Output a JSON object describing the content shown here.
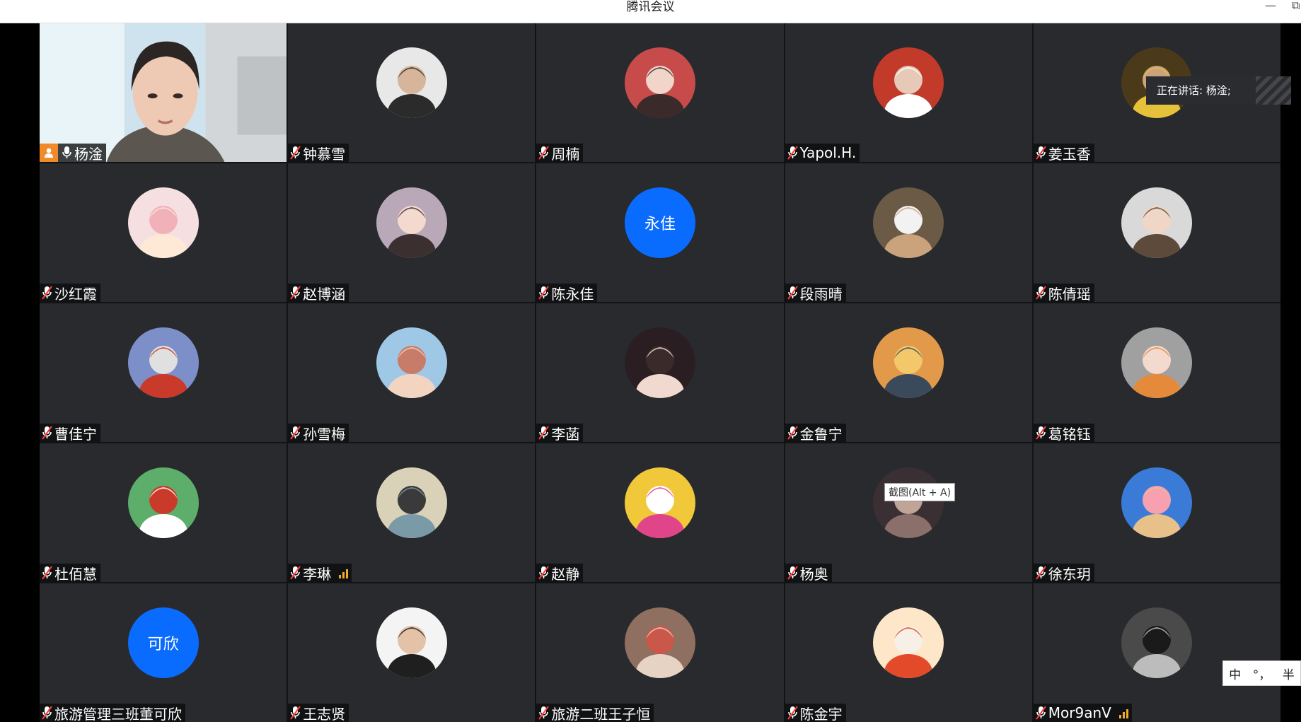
{
  "window": {
    "title": "腾讯会议",
    "min_label": "—",
    "restore_label": "⧉"
  },
  "speaking": {
    "text": "正在讲话: 杨淦;"
  },
  "tooltip": {
    "text": "截图(Alt + A)"
  },
  "ime": {
    "lang": "中",
    "punct": "°，",
    "width": "半"
  },
  "colors": {
    "tile_bg": "#282a2e",
    "accent_blue": "#0a6cff",
    "host_orange": "#f18a2a",
    "camera_border": "#2fbf6f"
  },
  "participants": [
    {
      "name": "杨淦",
      "type": "camera",
      "mic": "on",
      "host": true
    },
    {
      "name": "钟慕雪",
      "type": "photo",
      "icon": "avatar-man-portrait"
    },
    {
      "name": "周楠",
      "type": "photo",
      "icon": "avatar-girl-laughing"
    },
    {
      "name": "Yapol.H.",
      "type": "photo",
      "icon": "avatar-white-cat-cartoon"
    },
    {
      "name": "姜玉香",
      "type": "photo",
      "icon": "avatar-woman-yellow"
    },
    {
      "name": "沙红霞",
      "type": "photo",
      "icon": "avatar-pink-bunny"
    },
    {
      "name": "赵博涵",
      "type": "photo",
      "icon": "avatar-girl-braids"
    },
    {
      "name": "陈永佳",
      "type": "text",
      "initials": "永佳"
    },
    {
      "name": "段雨晴",
      "type": "photo",
      "icon": "avatar-child-good-glasses"
    },
    {
      "name": "陈倩瑶",
      "type": "photo",
      "icon": "avatar-girl-hands-face"
    },
    {
      "name": "曹佳宁",
      "type": "photo",
      "icon": "avatar-ultraman"
    },
    {
      "name": "孙雪梅",
      "type": "photo",
      "icon": "avatar-girl-camera"
    },
    {
      "name": "李菡",
      "type": "photo",
      "icon": "avatar-anime-girl"
    },
    {
      "name": "金鲁宁",
      "type": "photo",
      "icon": "avatar-sunset-figure"
    },
    {
      "name": "葛铭钰",
      "type": "photo",
      "icon": "avatar-girl-orange-pillow"
    },
    {
      "name": "杜佰慧",
      "type": "photo",
      "icon": "avatar-helmet-rider"
    },
    {
      "name": "李琳",
      "type": "photo",
      "icon": "avatar-jumping-beach",
      "signal": 3
    },
    {
      "name": "赵静",
      "type": "photo",
      "icon": "avatar-yellow-duck-pink-hat"
    },
    {
      "name": "杨奥",
      "type": "photo",
      "icon": "avatar-dim-room"
    },
    {
      "name": "徐东玥",
      "type": "photo",
      "icon": "avatar-cat-tongue"
    },
    {
      "name": "旅游管理三班董可欣",
      "type": "text",
      "initials": "可欣"
    },
    {
      "name": "王志贤",
      "type": "photo",
      "icon": "avatar-young-man-suit"
    },
    {
      "name": "旅游二班王子恒",
      "type": "photo",
      "icon": "avatar-street-girl"
    },
    {
      "name": "陈金宇",
      "type": "photo",
      "icon": "avatar-red-hair-cartoon"
    },
    {
      "name": "Mor9anV",
      "type": "photo",
      "icon": "avatar-man-newspaper-bw",
      "signal": 3
    }
  ]
}
